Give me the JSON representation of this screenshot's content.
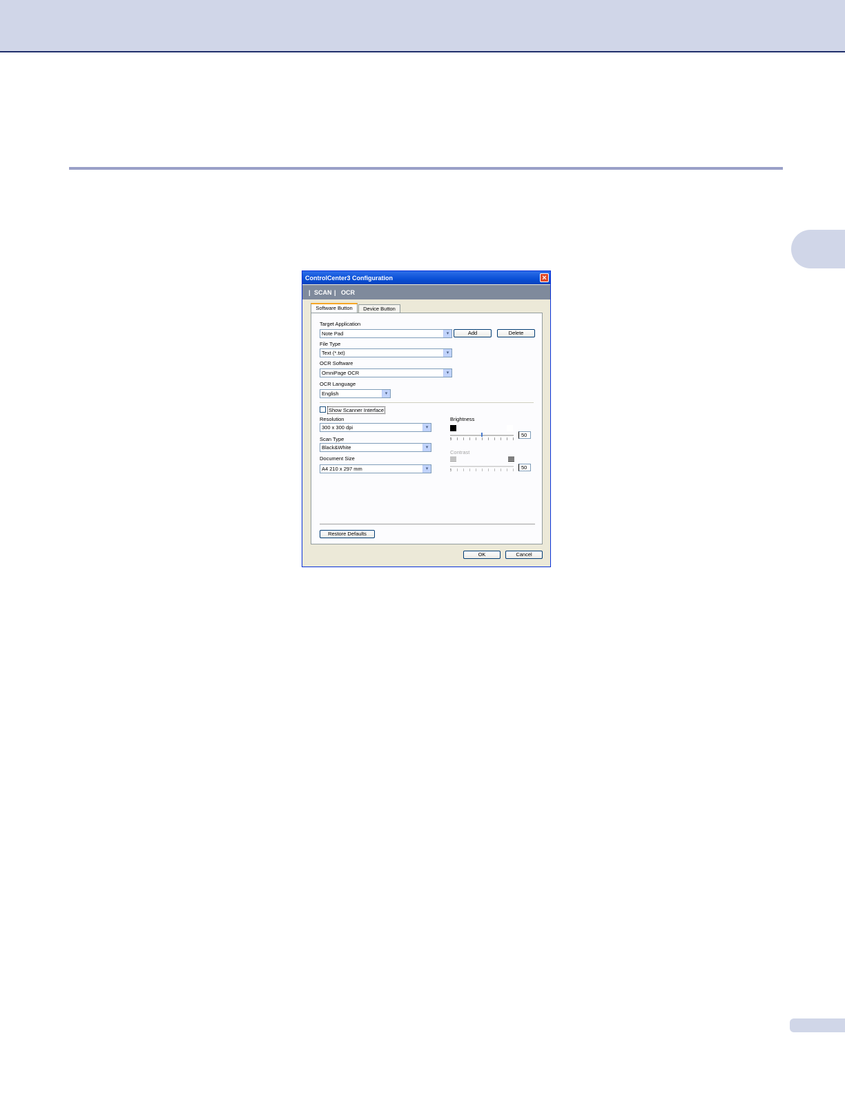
{
  "window": {
    "title": "ControlCenter3 Configuration",
    "close_glyph": "×"
  },
  "navbar": {
    "sep": "|",
    "items": [
      "SCAN",
      "OCR"
    ]
  },
  "tabs": [
    "Software Button",
    "Device Button"
  ],
  "form": {
    "target_application": {
      "label": "Target Application",
      "value": "Note Pad"
    },
    "file_type": {
      "label": "File Type",
      "value": "Text (*.txt)"
    },
    "ocr_software": {
      "label": "OCR Software",
      "value": "OmniPage OCR"
    },
    "ocr_language": {
      "label": "OCR Language",
      "value": "English"
    },
    "add_label": "Add",
    "delete_label": "Delete",
    "show_scanner_interface": {
      "label": "Show Scanner Interface",
      "checked": false
    },
    "resolution": {
      "label": "Resolution",
      "value": "300 x 300 dpi"
    },
    "scan_type": {
      "label": "Scan Type",
      "value": "Black&White"
    },
    "document_size": {
      "label": "Document Size",
      "value": "A4 210 x 297 mm"
    },
    "brightness": {
      "label": "Brightness",
      "value": "50"
    },
    "contrast": {
      "label": "Contrast",
      "value": "50",
      "disabled": true
    },
    "restore_defaults_label": "Restore Defaults"
  },
  "footer": {
    "ok_label": "OK",
    "cancel_label": "Cancel"
  },
  "colors": {
    "accent": "#0a4fd6",
    "header_band": "#d0d6e8",
    "nav": "#7f8a9c"
  }
}
